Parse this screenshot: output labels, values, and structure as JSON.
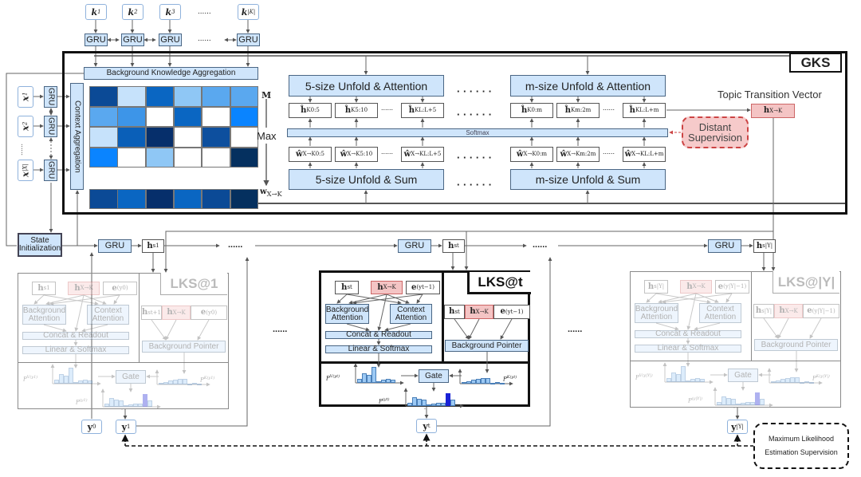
{
  "gks": {
    "label": "GKS",
    "knowledge": [
      {
        "b": "k",
        "s": "1"
      },
      {
        "b": "k",
        "s": "2"
      },
      {
        "b": "k",
        "s": "3"
      },
      {
        "b": "k",
        "s": "|K|"
      }
    ],
    "knowledge_ellipsis": "......",
    "gru": "GRU",
    "background_knowledge_aggregation": "Background Knowledge Aggregation",
    "context": [
      {
        "b": "x",
        "s": "1"
      },
      {
        "b": "x",
        "s": "2"
      },
      {
        "b": "x",
        "s": "|X|"
      }
    ],
    "context_ellipsis": "......",
    "context_aggregation": "Context Aggregation",
    "matrix_label": "M",
    "max_label": "Max",
    "w_label": {
      "b": "w",
      "s": "X→K"
    },
    "matrix_colors": [
      [
        "#0b4a96",
        "#c6e2fb",
        "#0a66c2",
        "#8fc7f5",
        "#5aa8ef",
        "#5aa8ef"
      ],
      [
        "#5aa8ef",
        "#3d95e8",
        "#ffffff",
        "#0a66c2",
        "#ffffff",
        "#0a84ff"
      ],
      [
        "#c6e2fb",
        "#0a5fb8",
        "#062f6b",
        "#ffffff",
        "#0d4f9e",
        "#ffffff"
      ],
      [
        "#0a84ff",
        "#ffffff",
        "#8fc7f5",
        "#ffffff",
        "#ffffff",
        "#05305f"
      ]
    ],
    "w_row_colors": [
      "#0b4a96",
      "#0a66c2",
      "#062f6b",
      "#0a66c2",
      "#0b4a96",
      "#05305f"
    ],
    "unfold_attention": [
      "5-size Unfold & Attention",
      "m-size Unfold & Attention"
    ],
    "h_hat": [
      [
        {
          "b": "ĥ",
          "s": "K0:5"
        },
        {
          "b": "ĥ",
          "s": "K5:10"
        },
        {
          "b": "ĥ",
          "s": "KL:L+5"
        }
      ],
      [
        {
          "b": "ĥ",
          "s": "K0:m"
        },
        {
          "b": "ĥ",
          "s": "Km:2m"
        },
        {
          "b": "ĥ",
          "s": "KL:L+m"
        }
      ]
    ],
    "softmax": "Softmax",
    "w_hat": [
      [
        {
          "b": "ŵ",
          "s": "X→K0:5"
        },
        {
          "b": "ŵ",
          "s": "X→K5:10"
        },
        {
          "b": "ŵ",
          "s": "X→KL:L+5"
        }
      ],
      [
        {
          "b": "ŵ",
          "s": "X→K0:m"
        },
        {
          "b": "ŵ",
          "s": "X→Km:2m"
        },
        {
          "b": "ŵ",
          "s": "X→KL:L+m"
        }
      ]
    ],
    "unfold_sum": [
      "5-size Unfold & Sum",
      "m-size Unfold & Sum"
    ],
    "small_dots": "......",
    "big_dots": "· · · · · ·",
    "topic_transition_title": "Topic Transition Vector",
    "topic_vector": {
      "b": "h",
      "s": "X→K"
    },
    "distant_supervision": "Distant Supervision",
    "colors": {
      "box_blue": "#cfe5fb",
      "topic_red": "#f4c4c4",
      "supervision_red": "#c44"
    }
  },
  "decoder": {
    "state_initialization": "State Initialization",
    "gru": "GRU",
    "hidden_states": [
      {
        "b": "h",
        "s": "s1"
      },
      {
        "b": "h",
        "s": "st"
      },
      {
        "b": "h",
        "s": "s|Y|"
      }
    ],
    "ellipsis": "......",
    "outputs": [
      {
        "b": "y",
        "s": "0"
      },
      {
        "b": "y",
        "s": "1"
      },
      {
        "b": "y",
        "s": "t"
      },
      {
        "b": "y",
        "s": "|Y|"
      }
    ],
    "mle_supervision": [
      "Maximum Likelihood",
      "Estimation Supervision"
    ]
  },
  "lks_panels": [
    {
      "title": "LKS@1",
      "faded": true,
      "h": {
        "b": "h",
        "s": "s1"
      },
      "h_right": {
        "b": "h",
        "s": "st+1"
      },
      "hx": {
        "b": "h",
        "s": "X→K"
      },
      "e": {
        "b": "e",
        "s": "(y0)"
      },
      "pv": {
        "b": "P",
        "s": "V(y1)"
      },
      "pk": {
        "b": "P",
        "s": "K(y1)"
      },
      "py": {
        "b": "P",
        "s": "(y1)"
      }
    },
    {
      "title": "LKS@t",
      "faded": false,
      "h": {
        "b": "h",
        "s": "st"
      },
      "h_right": {
        "b": "h",
        "s": "st"
      },
      "hx": {
        "b": "h",
        "s": "X→K"
      },
      "e": {
        "b": "e",
        "s": "(yt−1)"
      },
      "pv": {
        "b": "P",
        "s": "V(yt)"
      },
      "pk": {
        "b": "P",
        "s": "K(yt)"
      },
      "py": {
        "b": "P",
        "s": "(yt)"
      }
    },
    {
      "title": "LKS@|Y|",
      "faded": true,
      "h": {
        "b": "h",
        "s": "s|Y|"
      },
      "h_right": {
        "b": "h",
        "s": "s|Y|"
      },
      "hx": {
        "b": "h",
        "s": "X→K"
      },
      "e": {
        "b": "e",
        "s": "(y|Y|−1)"
      },
      "pv": {
        "b": "P",
        "s": "V(y|Y|)"
      },
      "pk": {
        "b": "P",
        "s": "K(y|Y|)"
      },
      "py": {
        "b": "P",
        "s": "(y|Y|)"
      }
    }
  ],
  "lks_labels": {
    "background_attention": [
      "Background",
      "Attention"
    ],
    "context_attention": [
      "Context",
      "Attention"
    ],
    "concat_readout": "Concat & Readout",
    "linear_softmax": "Linear & Softmax",
    "background_pointer": "Background Pointer",
    "gate": "Gate"
  },
  "distributions": {
    "vocab": [
      0.25,
      0.6,
      0.5,
      1.0,
      0.1,
      0.2,
      0.25,
      0.2
    ],
    "knowledge": [
      0.15,
      0.2,
      0.35,
      0.45,
      0.5,
      0.5,
      0.1,
      0.15,
      0.1
    ],
    "final": [
      0.2,
      0.6,
      0.5,
      0.45,
      0.1,
      0.15,
      0.2,
      0.25,
      0.9,
      0.45
    ],
    "final_highlight_index": 8
  }
}
